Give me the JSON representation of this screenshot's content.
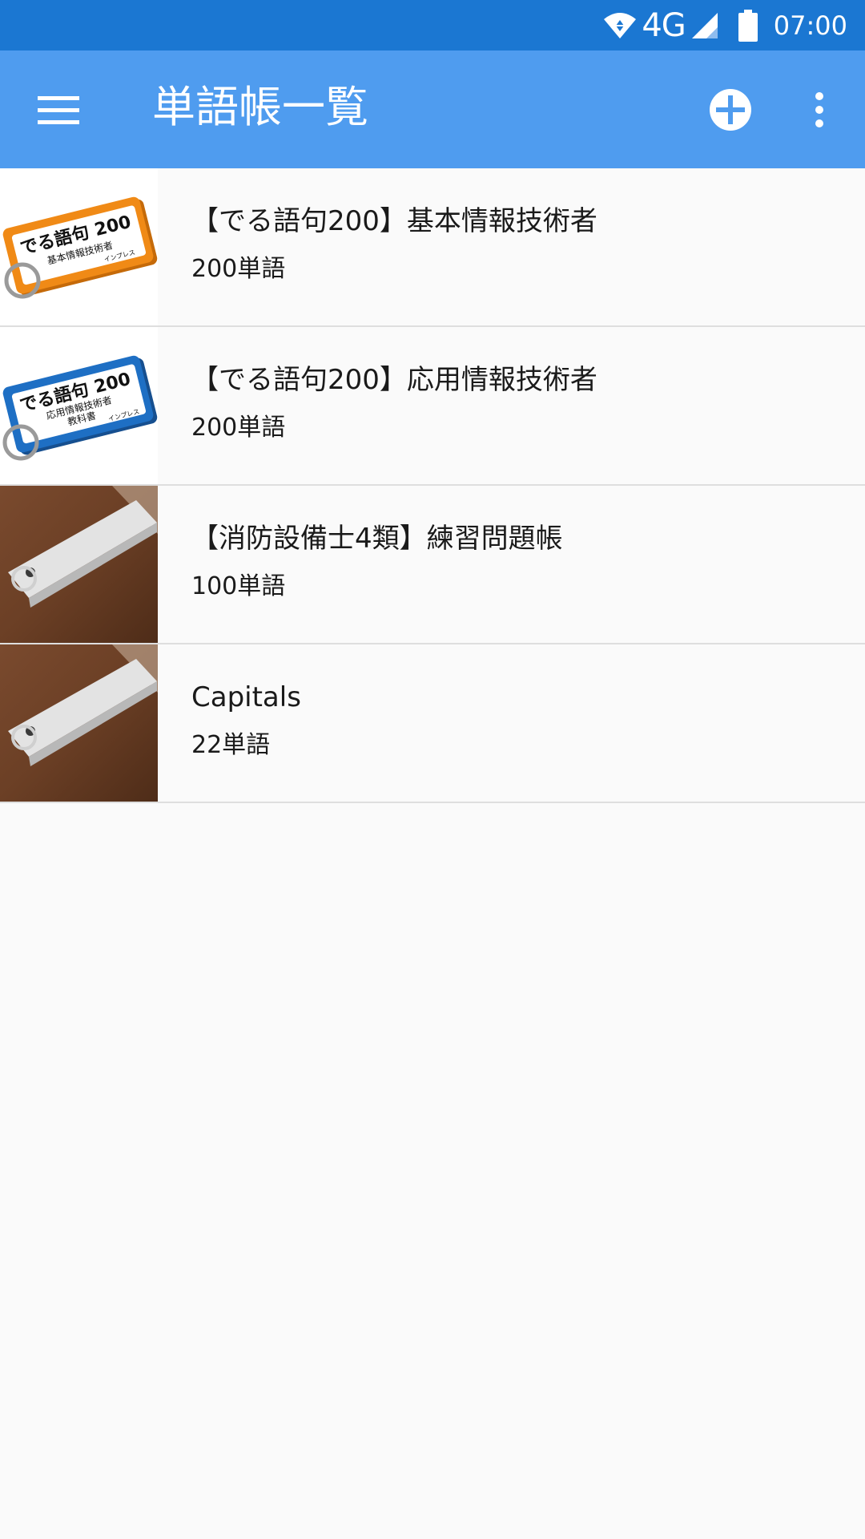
{
  "status_bar": {
    "network": "4G",
    "time": "07:00",
    "icons": [
      "wifi-icon",
      "signal-icon",
      "battery-icon"
    ]
  },
  "app_bar": {
    "title": "単語帳一覧",
    "menu_icon": "hamburger-menu-icon",
    "add_icon": "add-circle-icon",
    "more_icon": "more-vertical-icon",
    "background_color": "#4f9cef"
  },
  "decks": [
    {
      "title": "【でる語句200】基本情報技術者",
      "count": "200単語",
      "thumb": {
        "style": "tag",
        "color": "#f08a16",
        "main_text": "でる語句 200",
        "sub_text": "基本情報技術者",
        "sub_text2": "",
        "brand": "インプレス"
      }
    },
    {
      "title": "【でる語句200】応用情報技術者",
      "count": "200単語",
      "thumb": {
        "style": "tag",
        "color": "#1e6fc4",
        "main_text": "でる語句 200",
        "sub_text": "応用情報技術者",
        "sub_text2": "教科書",
        "brand": "インプレス"
      }
    },
    {
      "title": "【消防設備士4類】練習問題帳",
      "count": "100単語",
      "thumb": {
        "style": "photo"
      }
    },
    {
      "title": "Capitals",
      "count": "22単語",
      "thumb": {
        "style": "photo"
      }
    }
  ]
}
